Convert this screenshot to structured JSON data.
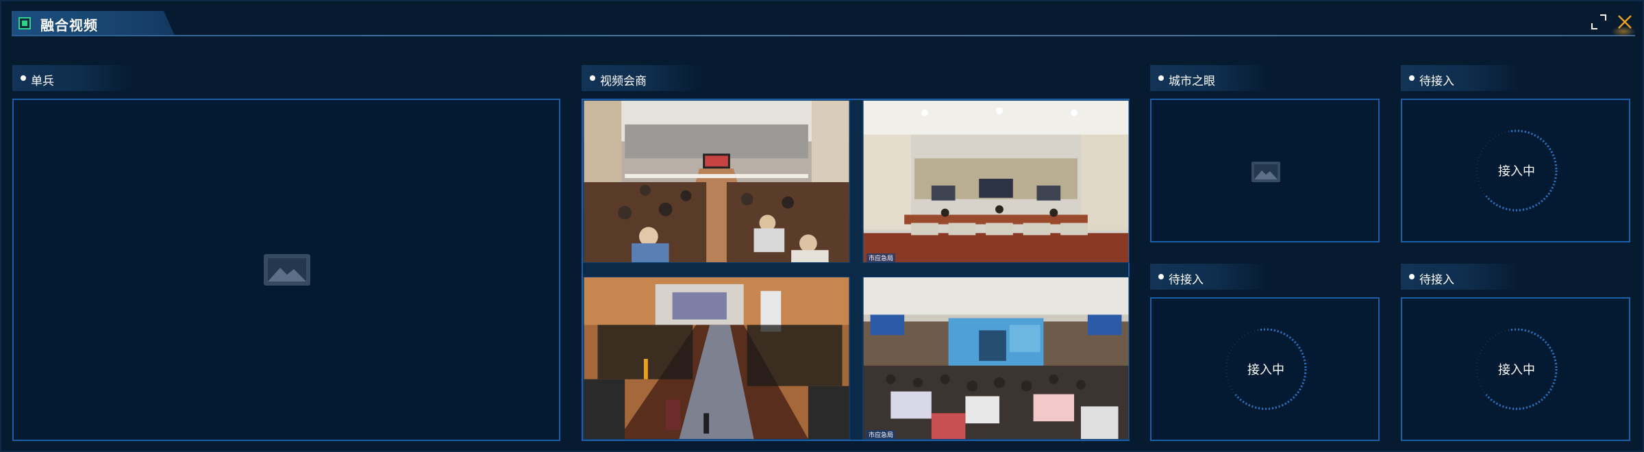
{
  "window": {
    "title": "融合视频"
  },
  "panels": {
    "single_soldier": {
      "title": "单兵"
    },
    "video_conference": {
      "title": "视频会商",
      "tiles": [
        {
          "tag": ""
        },
        {
          "tag": "市应急局"
        },
        {
          "tag": ""
        },
        {
          "tag": "市应急局"
        }
      ]
    },
    "city_eye": {
      "title": "城市之眼"
    },
    "pending": [
      {
        "title": "待接入",
        "status": "接入中"
      },
      {
        "title": "待接入",
        "status": "接入中"
      },
      {
        "title": "待接入",
        "status": "接入中"
      }
    ]
  },
  "icons": {
    "title": "video-fusion-icon",
    "expand": "expand-icon",
    "close": "close-icon",
    "placeholder": "image-placeholder-icon"
  },
  "colors": {
    "background": "#061a30",
    "panel_border": "#1a5fa8",
    "accent_green": "#2fd28a",
    "close_orange": "#f0a020",
    "spinner_blue": "#2a7fd4"
  }
}
